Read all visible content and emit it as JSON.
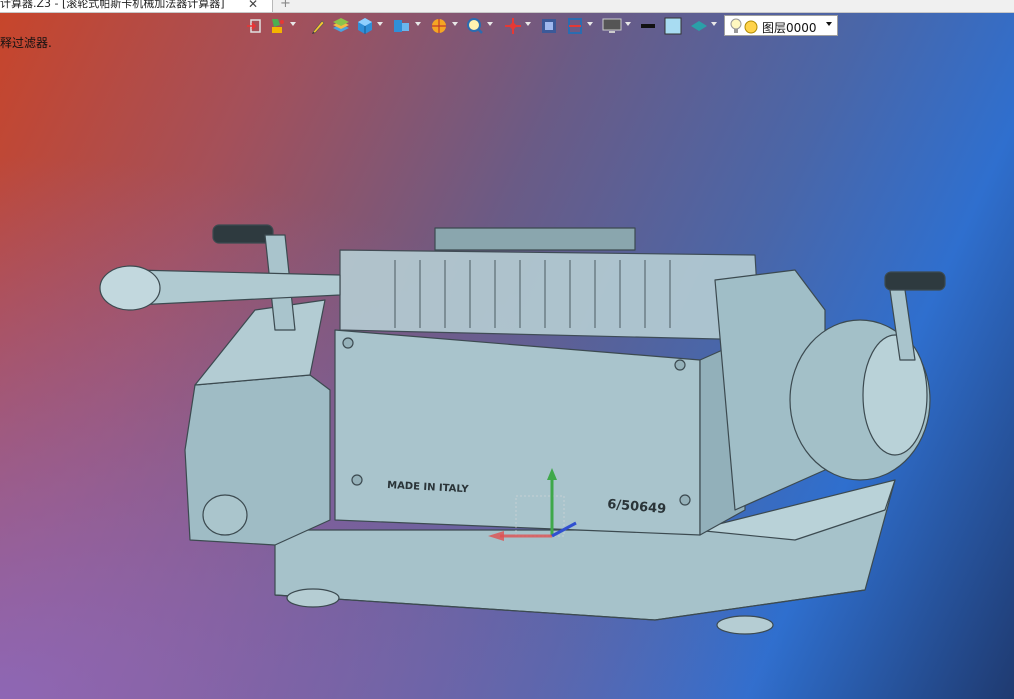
{
  "window": {
    "tab_title": "计算器.Z3 - [滚轮式帕斯卡机械加法器计算器]",
    "close_glyph": "✕",
    "new_tab_glyph": "+"
  },
  "viewport": {
    "status_hint": "释过滤器.",
    "model_text": {
      "made_in": "MADE IN ITALY",
      "serial": "6/50649"
    }
  },
  "toolbar": {
    "icons": [
      "exit-sketch-icon",
      "paint-icon",
      "pencil-icon",
      "layer-stack-icon",
      "cube-view-icon",
      "part-icon",
      "render-icon",
      "zoom-icon",
      "pan-icon",
      "fit-view-icon",
      "section-icon",
      "display-icon",
      "line-color-icon",
      "fill-color-icon",
      "surface-icon",
      "bulb-icon"
    ],
    "layer": {
      "label": "图层0000",
      "light_color": "#ffd34a"
    }
  },
  "colors": {
    "model_body": "#a9c4cc",
    "model_edge": "#3c4a50"
  }
}
